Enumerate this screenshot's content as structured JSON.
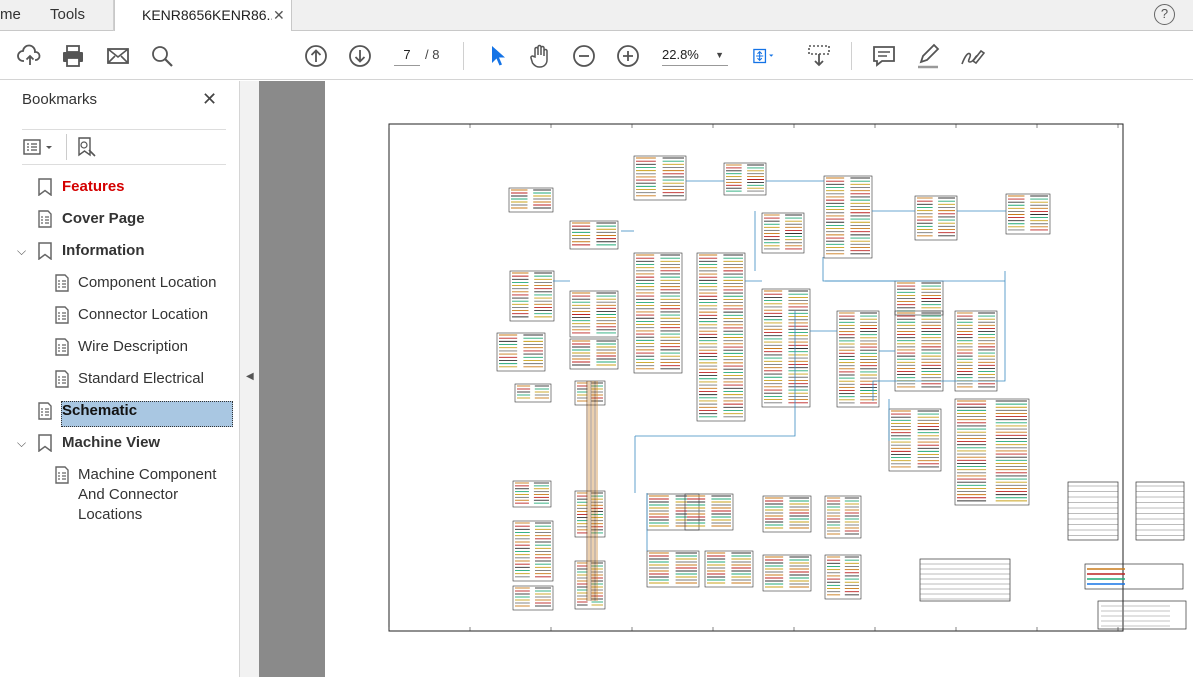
{
  "tabs": {
    "home_clip": "me",
    "tools": "Tools",
    "document": "KENR8656KENR86...",
    "close": "✕"
  },
  "help": "?",
  "toolbar": {
    "current_page": "7",
    "total_pages": "/ 8",
    "zoom": "22.8%"
  },
  "sidebar": {
    "title": "Bookmarks",
    "close": "✕",
    "items": [
      {
        "label": "Features"
      },
      {
        "label": "Cover Page"
      },
      {
        "label": "Information"
      },
      {
        "label": "Component Location"
      },
      {
        "label": "Connector Location"
      },
      {
        "label": "Wire Description"
      },
      {
        "label": "Standard Electrical"
      },
      {
        "label": "Schematic"
      },
      {
        "label": "Machine View"
      },
      {
        "label": "Machine Component\nAnd Connector\nLocations"
      }
    ]
  },
  "icons": {
    "upload": "cloud-upload-icon",
    "print": "printer-icon",
    "mail": "envelope-icon",
    "search": "magnifier-icon",
    "prev": "arrow-up-circle-icon",
    "next": "arrow-down-circle-icon",
    "select": "cursor-icon",
    "hand": "hand-icon",
    "zoom_out": "minus-circle-icon",
    "zoom_in": "plus-circle-icon",
    "fit": "fit-page-icon",
    "scroll": "scroll-mode-icon",
    "comment": "comment-icon",
    "highlight": "pen-icon",
    "sign": "sign-icon"
  },
  "colors": {
    "accent": "#1473e6",
    "selected_bookmark": "#a9c7e2",
    "features_red": "#d40000",
    "doc_background": "#8a8a8a"
  }
}
